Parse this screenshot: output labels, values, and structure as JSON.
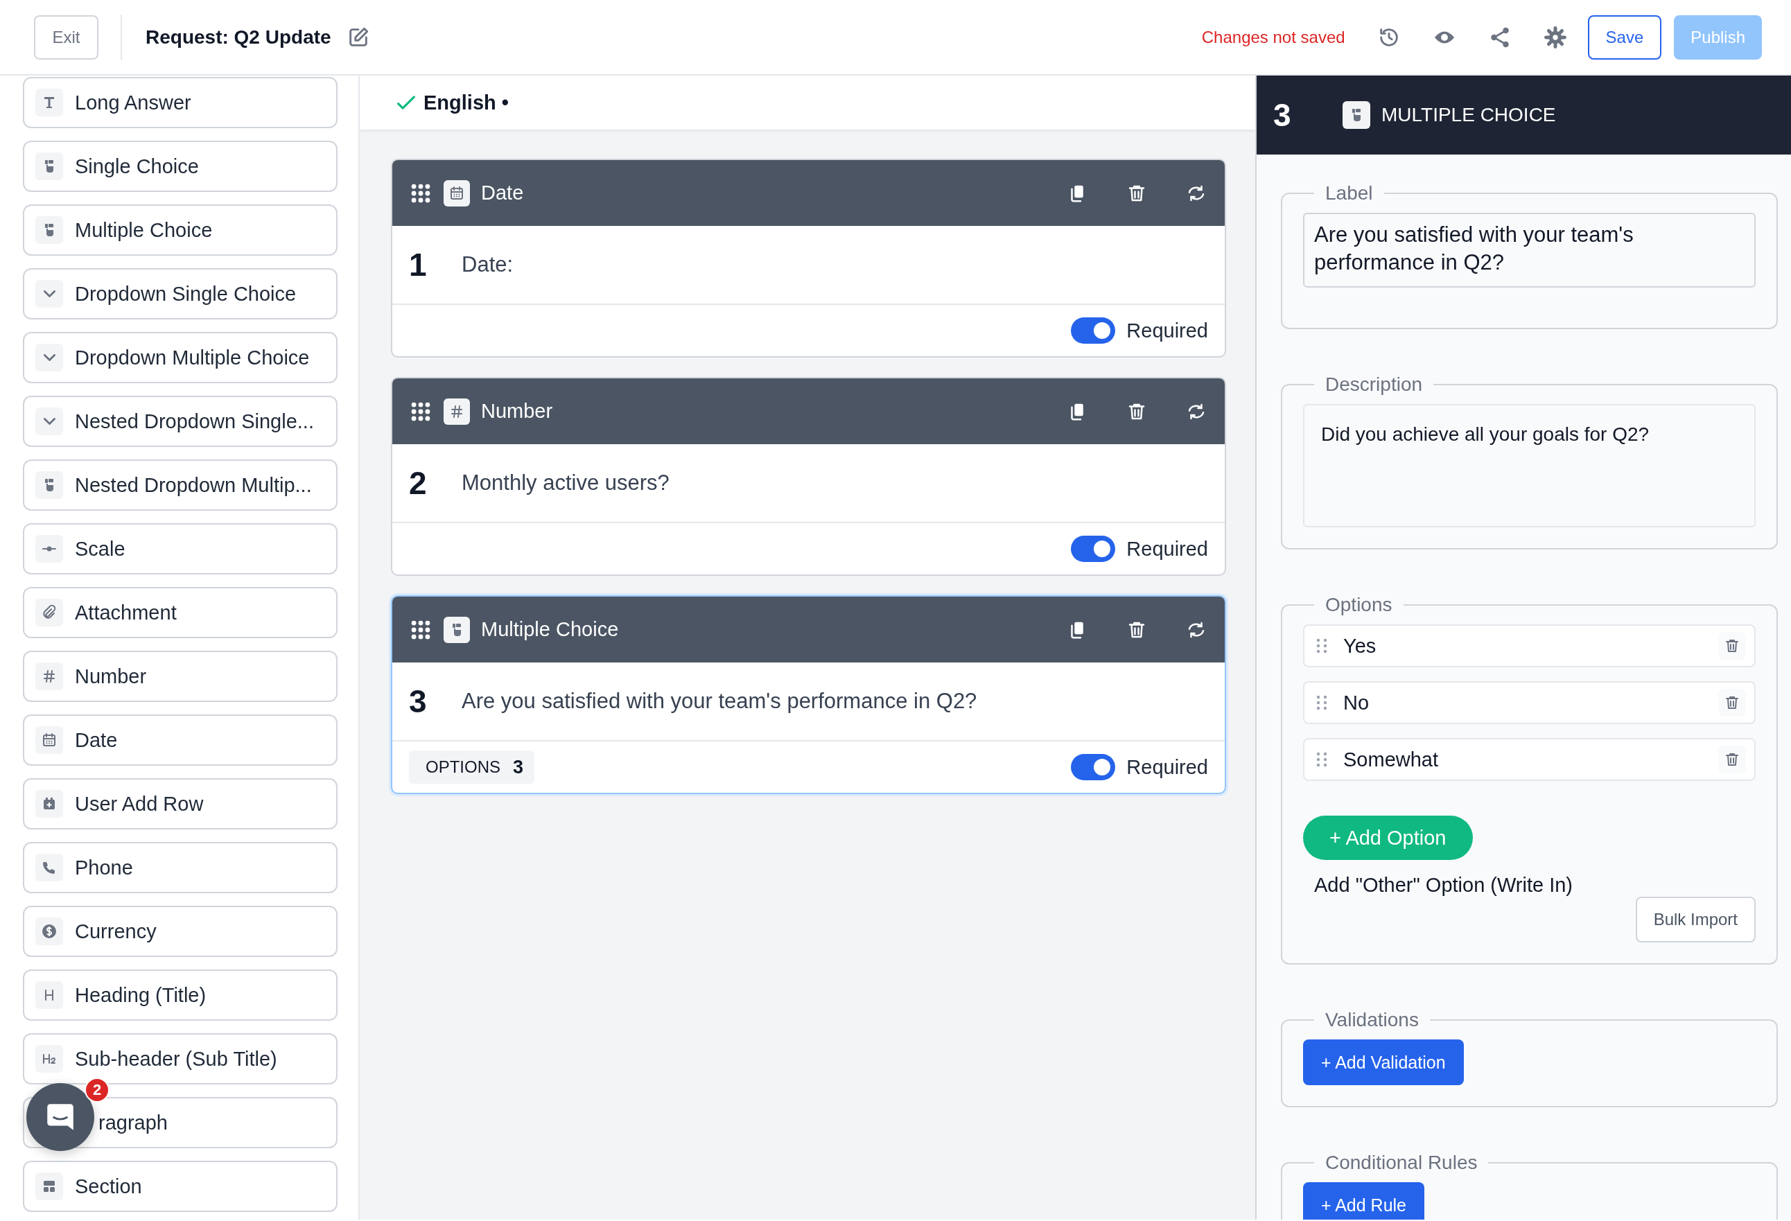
{
  "header": {
    "exit": "Exit",
    "title": "Request: Q2 Update",
    "status": "Changes not saved",
    "save": "Save",
    "publish": "Publish",
    "publish_disabled": true
  },
  "palette": [
    {
      "label": "Long Answer",
      "kind": "text",
      "covered": false
    },
    {
      "label": "Single Choice",
      "kind": "choice",
      "covered": false
    },
    {
      "label": "Multiple Choice",
      "kind": "choice",
      "covered": false
    },
    {
      "label": "Dropdown Single Choice",
      "kind": "dropdown",
      "covered": false
    },
    {
      "label": "Dropdown Multiple Choice",
      "kind": "dropdown",
      "covered": false
    },
    {
      "label": "Nested Dropdown Single...",
      "kind": "dropdown",
      "covered": false
    },
    {
      "label": "Nested Dropdown Multip...",
      "kind": "choice",
      "covered": false
    },
    {
      "label": "Scale",
      "kind": "scale",
      "covered": false
    },
    {
      "label": "Attachment",
      "kind": "attachment",
      "covered": false
    },
    {
      "label": "Number",
      "kind": "number",
      "covered": false
    },
    {
      "label": "Date",
      "kind": "date",
      "covered": false
    },
    {
      "label": "User Add Row",
      "kind": "addrow",
      "covered": false
    },
    {
      "label": "Phone",
      "kind": "phone",
      "covered": false
    },
    {
      "label": "Currency",
      "kind": "currency",
      "covered": false
    },
    {
      "label": "Heading (Title)",
      "kind": "heading",
      "covered": false
    },
    {
      "label": "Sub-header (Sub Title)",
      "kind": "subheading",
      "covered": false
    },
    {
      "label": "ragraph",
      "covered": true
    },
    {
      "label": "Section",
      "kind": "section",
      "covered": false
    }
  ],
  "language": {
    "label": "English",
    "dot": "•",
    "done": true
  },
  "questions": [
    {
      "number": "1",
      "kind": "date",
      "type_label": "Date",
      "text": "Date:",
      "required": true,
      "required_label": "Required",
      "selected": false
    },
    {
      "number": "2",
      "kind": "number",
      "type_label": "Number",
      "text": "Monthly active users?",
      "required": true,
      "required_label": "Required",
      "selected": false
    },
    {
      "number": "3",
      "kind": "choice",
      "type_label": "Multiple Choice",
      "text": "Are you satisfied with your team's performance in Q2?",
      "options_label": "OPTIONS",
      "options_count": "3",
      "required": true,
      "required_label": "Required",
      "selected": true
    }
  ],
  "editor": {
    "number": "3",
    "kind": "choice",
    "type_label": "MULTIPLE CHOICE",
    "label_legend": "Label",
    "label_value": "Are you satisfied with your team's performance in Q2?",
    "description_legend": "Description",
    "description_value": "Did you achieve all your goals for Q2?",
    "options_legend": "Options",
    "options": [
      {
        "label": "Yes"
      },
      {
        "label": "No"
      },
      {
        "label": "Somewhat"
      }
    ],
    "add_option": "+ Add Option",
    "other_option": "Add \"Other\" Option (Write In)",
    "bulk_import": "Bulk Import",
    "validations_legend": "Validations",
    "add_validation": "+ Add Validation",
    "rules_legend": "Conditional Rules",
    "add_rule": "+ Add Rule"
  },
  "chat": {
    "badge": "2"
  }
}
